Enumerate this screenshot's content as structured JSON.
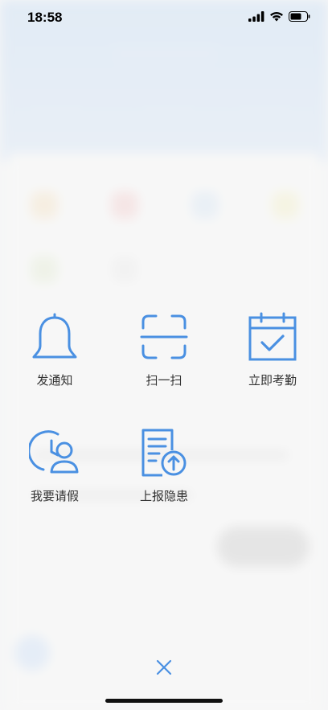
{
  "status_bar": {
    "time": "18:58",
    "icons": [
      "signal-icon",
      "wifi-icon",
      "battery-icon"
    ]
  },
  "menu": {
    "items": [
      {
        "label": "发通知",
        "icon": "bell-icon"
      },
      {
        "label": "扫一扫",
        "icon": "scan-icon"
      },
      {
        "label": "立即考勤",
        "icon": "calendar-check-icon"
      },
      {
        "label": "我要请假",
        "icon": "clock-person-icon"
      },
      {
        "label": "上报隐患",
        "icon": "document-upload-icon"
      }
    ]
  },
  "close": {
    "icon": "close-icon"
  },
  "colors": {
    "accent": "#4a90e2",
    "label": "#333333",
    "header_bg": "#c7dcf2"
  }
}
